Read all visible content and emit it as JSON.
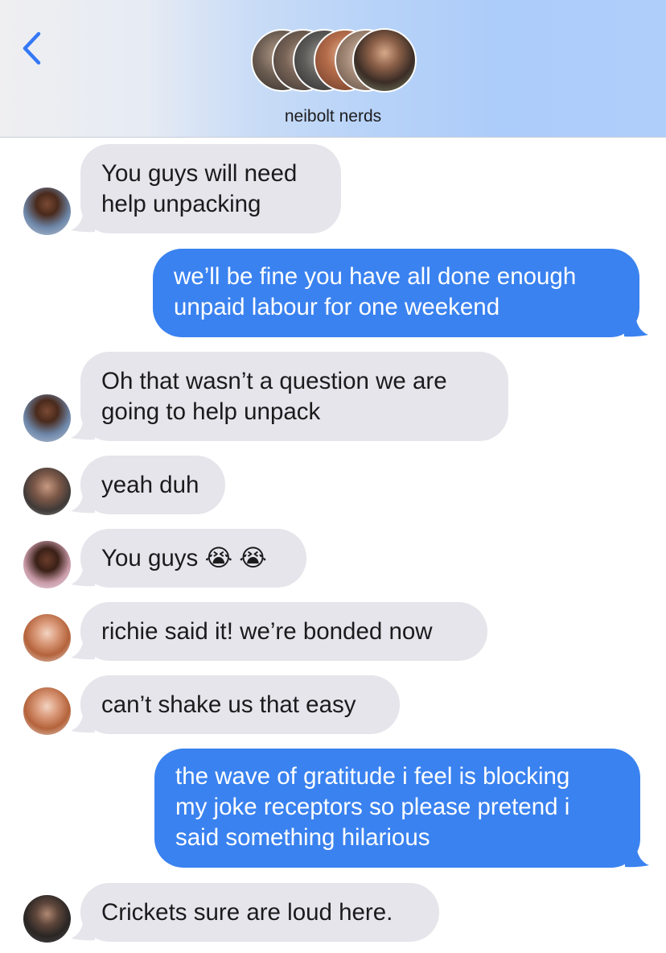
{
  "header": {
    "group_name": "neibolt nerds",
    "back_icon": "chevron-left-icon",
    "accent_color": "#3478f6"
  },
  "colors": {
    "incoming_bubble": "#e6e5eb",
    "outgoing_bubble": "#3a82f0"
  },
  "messages": [
    {
      "direction": "in",
      "text": "You guys will need\nhelp unpacking",
      "sender": "friend-1"
    },
    {
      "direction": "out",
      "text": "we’ll be fine you have all done enough\nunpaid labour for one weekend"
    },
    {
      "direction": "in",
      "text": "Oh that wasn’t a question we are\ngoing to help unpack",
      "sender": "friend-1"
    },
    {
      "direction": "in",
      "text": "yeah duh",
      "sender": "friend-2"
    },
    {
      "direction": "in",
      "text": "You guys 😭 😭",
      "sender": "friend-3"
    },
    {
      "direction": "in",
      "text": "richie said it! we’re bonded now",
      "sender": "friend-4"
    },
    {
      "direction": "in",
      "text": "can’t shake us that easy",
      "sender": "friend-4"
    },
    {
      "direction": "out",
      "text": "the wave of gratitude i feel is blocking\nmy joke receptors so please pretend i\nsaid something hilarious"
    },
    {
      "direction": "in",
      "text": "Crickets sure are loud here.",
      "sender": "friend-5"
    }
  ]
}
